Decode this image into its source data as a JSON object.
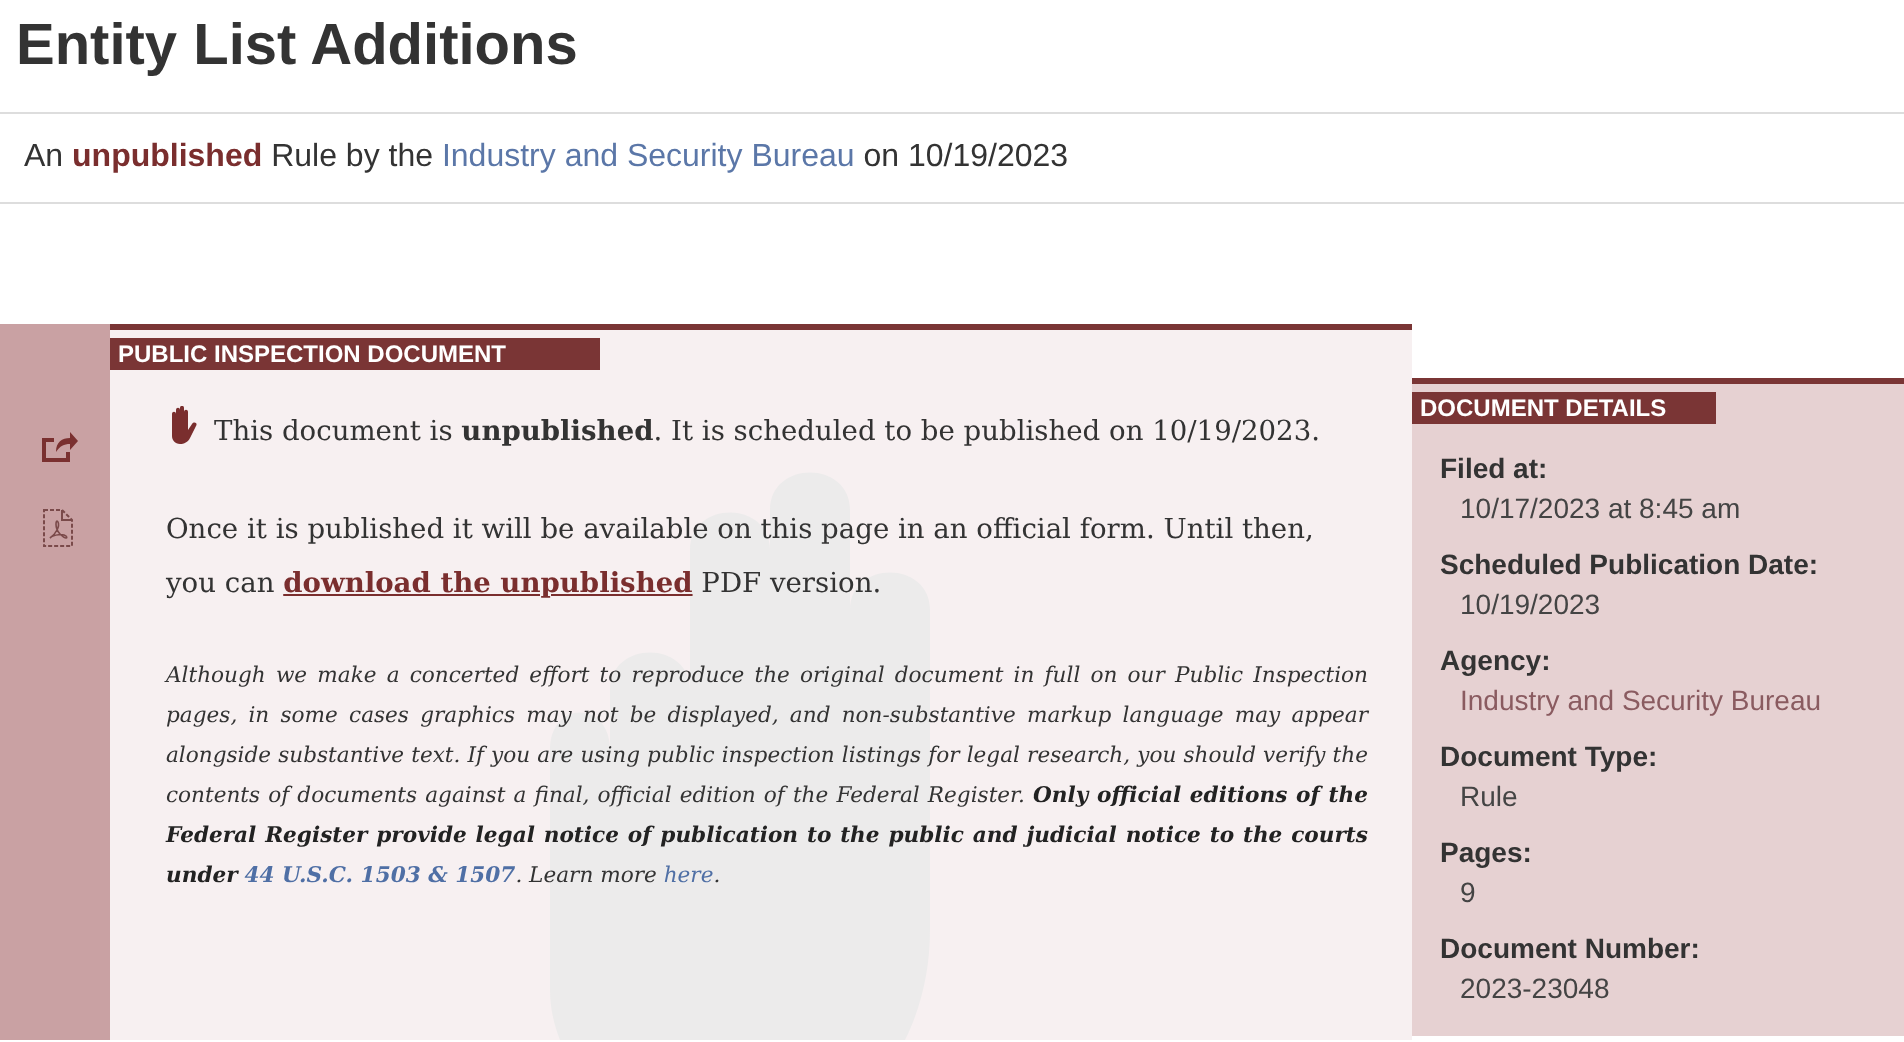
{
  "title": "Entity List Additions",
  "byline": [
    {
      "kind": "text",
      "text": "An "
    },
    {
      "kind": "bold",
      "text": "unpublished"
    },
    {
      "kind": "text",
      "text": " Rule by the "
    },
    {
      "kind": "link",
      "text": "Industry and Security Bureau"
    },
    {
      "kind": "text",
      "text": " on 10/19/2023"
    }
  ],
  "sidebar": {
    "actions": [
      {
        "kind": "share"
      },
      {
        "kind": "pdf"
      }
    ]
  },
  "inspection": {
    "header": "PUBLIC INSPECTION DOCUMENT",
    "paragraphs": [
      {
        "kind": "notice",
        "segments": [
          {
            "kind": "text",
            "text": "This document is **unpublished**. It is scheduled to be published on 10/19/2023."
          }
        ]
      },
      {
        "kind": "normal",
        "segments": [
          {
            "kind": "text",
            "text": "Once it is published it will be available on this page in an official form. Until then, you can "
          },
          {
            "kind": "link",
            "text": "download the unpublished"
          },
          {
            "kind": "text",
            "text": " PDF version."
          }
        ]
      },
      {
        "kind": "disclaimer",
        "segments": [
          {
            "kind": "text",
            "text": "Although we make a concerted effort to reproduce the original document in full on our Public Inspection pages, in some cases graphics may not be displayed, and non-substantive markup language may appear alongside substantive text. If you are using public inspection listings for legal research, you should verify the contents of documents against a final, official edition of the Federal Register. **Only official editions of the Federal Register provide legal notice of publication to the public and judicial notice to the courts under** "
          },
          {
            "kind": "link",
            "text": "44 U.S.C. 1503 & 1507"
          },
          {
            "kind": "text",
            "text": ". Learn more "
          },
          {
            "kind": "link",
            "text": "here"
          },
          {
            "kind": "text",
            "text": "."
          }
        ]
      }
    ]
  },
  "details": {
    "header": "DOCUMENT DETAILS",
    "items": [
      {
        "label": "Filed at:",
        "value": "10/17/2023 at 8:45 am",
        "kind": "text"
      },
      {
        "label": "Scheduled Publication Date:",
        "value": "10/19/2023",
        "kind": "text"
      },
      {
        "label": "Agency:",
        "value": "Industry and Security Bureau",
        "kind": "link"
      },
      {
        "label": "Document Type:",
        "value": "Rule",
        "kind": "text"
      },
      {
        "label": "Pages:",
        "value": "9",
        "kind": "text"
      },
      {
        "label": "Document Number:",
        "value": "2023-23048",
        "kind": "text"
      }
    ]
  }
}
